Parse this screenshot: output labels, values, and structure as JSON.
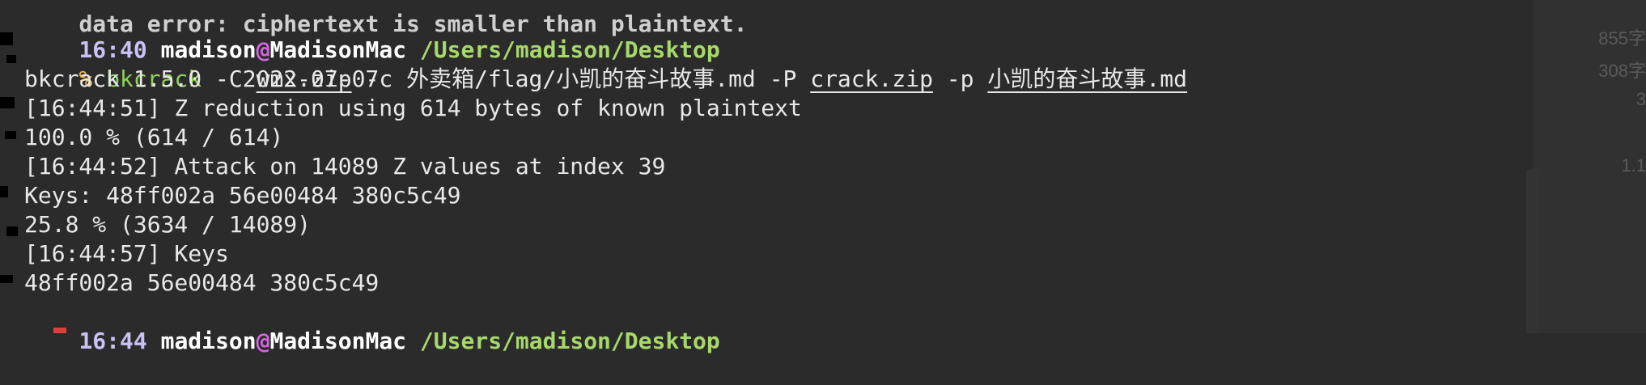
{
  "colors": {
    "background": "#2b2b2b",
    "time": "#cbc1f4",
    "user": "#ffffff",
    "at_sign": "#d466e0",
    "path": "#a6d86a",
    "prompt_char": "#e8b34a",
    "command": "#8fd35a",
    "text": "#e8e8e8"
  },
  "prompt1": {
    "time": "16:40",
    "user": "madison",
    "at": "@",
    "host": "MadisonMac",
    "path": "/Users/madison/Desktop"
  },
  "command_line": {
    "prompt_char": "%",
    "cmd": "bkcrack",
    "flag_C": "-C",
    "arg_C": "wmx.zip",
    "flag_c": "-c",
    "arg_c": "外卖箱/flag/小凯的奋斗故事.md",
    "flag_P": "-P",
    "arg_P": "crack.zip",
    "flag_p": "-p",
    "arg_p": "小凯的奋斗故事.md"
  },
  "output": [
    "bkcrack 1.5.0 - 2022-07-07",
    "[16:44:51] Z reduction using 614 bytes of known plaintext",
    "100.0 % (614 / 614)",
    "[16:44:52] Attack on 14089 Z values at index 39",
    "Keys: 48ff002a 56e00484 380c5c49",
    "25.8 % (3634 / 14089)",
    "[16:44:57] Keys",
    "48ff002a 56e00484 380c5c49"
  ],
  "prompt2": {
    "time": "16:44",
    "user": "madison",
    "at": "@",
    "host": "MadisonMac",
    "path": "/Users/madison/Desktop"
  },
  "background_panel": [
    "855字",
    "308字",
    "3",
    "1.1"
  ]
}
